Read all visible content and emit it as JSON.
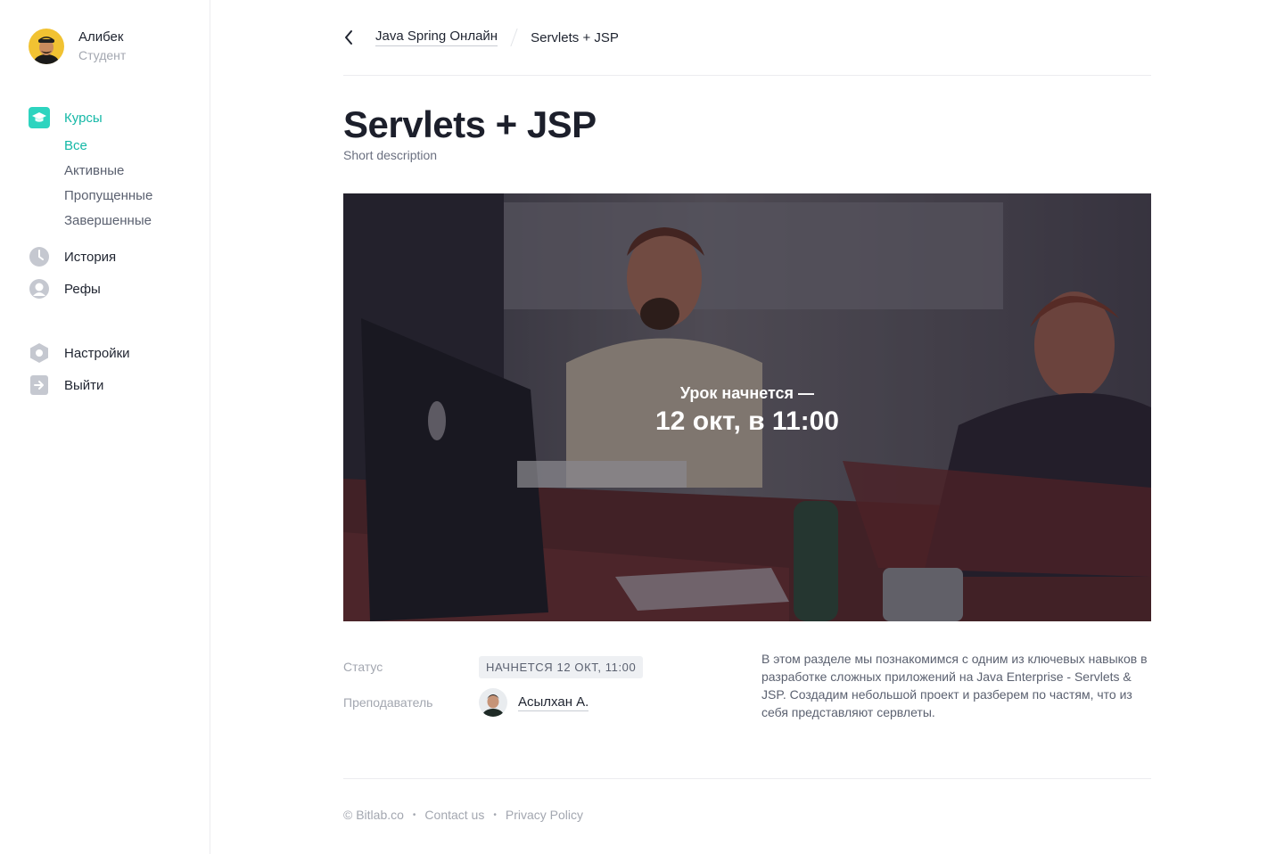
{
  "user": {
    "name": "Алибек",
    "role": "Студент"
  },
  "nav": {
    "courses": "Курсы",
    "sub": [
      "Все",
      "Активные",
      "Пропущенные",
      "Завершенные"
    ],
    "history": "История",
    "refs": "Рефы",
    "settings": "Настройки",
    "logout": "Выйти"
  },
  "breadcrumb": {
    "parent": "Java Spring Онлайн",
    "current": "Servlets + JSP"
  },
  "lesson": {
    "title": "Servlets + JSP",
    "short_description": "Short description",
    "starts_label": "Урок начнется —",
    "starts_time": "12 окт, в 11:00",
    "status_label": "Статус",
    "status_value": "НАЧНЕТСЯ 12 ОКТ, 11:00",
    "teacher_label": "Преподаватель",
    "teacher_name": "Асылхан А.",
    "description": "В этом разделе мы познакомимся с одним из ключевых навыков в разработке сложных приложений на Java Enterprise - Servlets & JSP. Создадим небольшой проект и разберем по частям, что из себя представляют сервлеты."
  },
  "footer": {
    "copyright": "© Bitlab.co",
    "contact": "Contact us",
    "privacy": "Privacy Policy"
  },
  "colors": {
    "accent": "#14b8a6",
    "text": "#1f2430",
    "muted": "#a3a7b0"
  },
  "icons": {
    "courses": "graduation-cap-icon",
    "history": "clock-icon",
    "refs": "user-circle-icon",
    "settings": "gear-icon",
    "logout": "logout-arrow-icon",
    "back": "chevron-left-icon"
  }
}
